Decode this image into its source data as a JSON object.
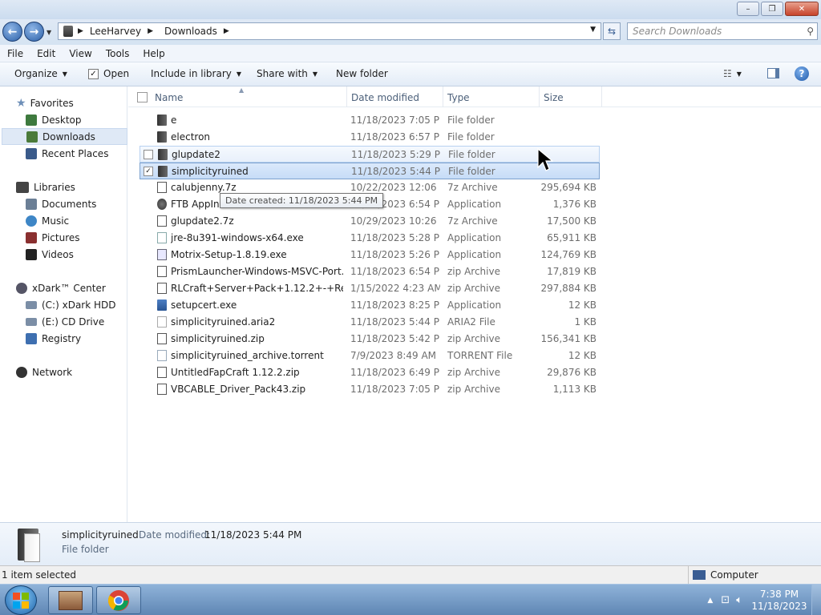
{
  "window": {
    "minimize": "–",
    "maximize": "❐",
    "close": "✕"
  },
  "nav": {
    "back_icon": "←",
    "forward_icon": "→",
    "breadcrumb": [
      "LeeHarvey",
      "Downloads"
    ],
    "search_placeholder": "Search Downloads"
  },
  "menu": [
    "File",
    "Edit",
    "View",
    "Tools",
    "Help"
  ],
  "toolbar": {
    "organize": "Organize",
    "open": "Open",
    "include": "Include in library",
    "share": "Share with",
    "new_folder": "New folder"
  },
  "sidebar": {
    "favorites": "Favorites",
    "favorites_items": [
      "Desktop",
      "Downloads",
      "Recent Places"
    ],
    "libraries": "Libraries",
    "libraries_items": [
      "Documents",
      "Music",
      "Pictures",
      "Videos"
    ],
    "homegroup": "xDark™ Center",
    "computer_items": [
      "(C:) xDark HDD",
      "(E:) CD Drive",
      "Registry"
    ],
    "network": "Network"
  },
  "columns": {
    "name": "Name",
    "date": "Date modified",
    "type": "Type",
    "size": "Size"
  },
  "files": [
    {
      "name": "e",
      "date": "11/18/2023 7:05 PM",
      "type": "File folder",
      "size": "",
      "icon": "folder-icon"
    },
    {
      "name": "electron",
      "date": "11/18/2023 6:57 PM",
      "type": "File folder",
      "size": "",
      "icon": "folder-icon"
    },
    {
      "name": "glupdate2",
      "date": "11/18/2023 5:29 PM",
      "type": "File folder",
      "size": "",
      "icon": "folder-icon"
    },
    {
      "name": "simplicityruined",
      "date": "11/18/2023 5:44 PM",
      "type": "File folder",
      "size": "",
      "icon": "folder-icon"
    },
    {
      "name": "calubjenny.7z",
      "date": "10/22/2023 12:06 ...",
      "type": "7z Archive",
      "size": "295,694 KB",
      "icon": "archive-icon"
    },
    {
      "name": "FTB AppIns",
      "date": "11/18/2023 6:54 PM",
      "type": "Application",
      "size": "1,376 KB",
      "icon": "app-icon"
    },
    {
      "name": "glupdate2.7z",
      "date": "10/29/2023 10:26 ...",
      "type": "7z Archive",
      "size": "17,500 KB",
      "icon": "archive-icon"
    },
    {
      "name": "jre-8u391-windows-x64.exe",
      "date": "11/18/2023 5:28 PM",
      "type": "Application",
      "size": "65,911 KB",
      "icon": "java-icon"
    },
    {
      "name": "Motrix-Setup-1.8.19.exe",
      "date": "11/18/2023 5:26 PM",
      "type": "Application",
      "size": "124,769 KB",
      "icon": "installer-icon"
    },
    {
      "name": "PrismLauncher-Windows-MSVC-Port...",
      "date": "11/18/2023 6:54 PM",
      "type": "zip Archive",
      "size": "17,819 KB",
      "icon": "archive-icon"
    },
    {
      "name": "RLCraft+Server+Pack+1.12.2+-+Relea...",
      "date": "1/15/2022 4:23 AM",
      "type": "zip Archive",
      "size": "297,884 KB",
      "icon": "archive-icon"
    },
    {
      "name": "setupcert.exe",
      "date": "11/18/2023 8:25 PM",
      "type": "Application",
      "size": "12 KB",
      "icon": "exe-icon"
    },
    {
      "name": "simplicityruined.aria2",
      "date": "11/18/2023 5:44 PM",
      "type": "ARIA2 File",
      "size": "1 KB",
      "icon": "file-icon"
    },
    {
      "name": "simplicityruined.zip",
      "date": "11/18/2023 5:42 PM",
      "type": "zip Archive",
      "size": "156,341 KB",
      "icon": "archive-icon"
    },
    {
      "name": "simplicityruined_archive.torrent",
      "date": "7/9/2023 8:49 AM",
      "type": "TORRENT File",
      "size": "12 KB",
      "icon": "torrent-icon"
    },
    {
      "name": "UntitledFapCraft 1.12.2.zip",
      "date": "11/18/2023 6:49 PM",
      "type": "zip Archive",
      "size": "29,876 KB",
      "icon": "archive-icon"
    },
    {
      "name": "VBCABLE_Driver_Pack43.zip",
      "date": "11/18/2023 7:05 PM",
      "type": "zip Archive",
      "size": "1,113 KB",
      "icon": "archive-icon"
    }
  ],
  "tooltip": "Date created: 11/18/2023 5:44 PM",
  "details": {
    "name": "simplicityruined",
    "date_label": "Date modified:",
    "date_value": "11/18/2023 5:44 PM",
    "type": "File folder"
  },
  "status": {
    "left": "1 item selected",
    "right": "Computer"
  },
  "clock": {
    "time": "7:38 PM",
    "date": "11/18/2023"
  }
}
